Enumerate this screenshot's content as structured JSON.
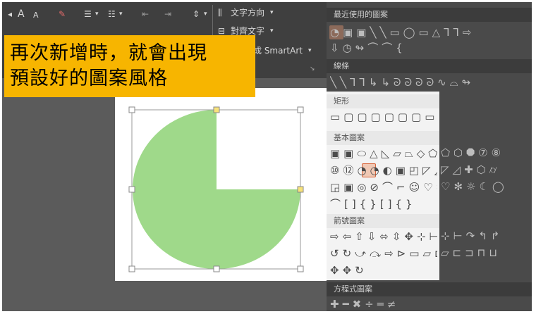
{
  "ribbon": {
    "font_grow": "A",
    "font_shrink": "A",
    "text_direction_label": "文字方向",
    "align_text_label": "對齊文字",
    "smartart_label": "成 SmartArt",
    "dropdown_arrow": "▾",
    "launcher_glyph": "↘"
  },
  "callout": {
    "line1": "再次新增時，就會出現",
    "line2": "預設好的圖案風格",
    "color": "#f7b500"
  },
  "gallery": {
    "sections": {
      "recent": "最近使用的圖案",
      "lines": "線條",
      "rectangles": "矩形",
      "basic": "基本圖案",
      "arrows": "箭號圖案",
      "equation": "方程式圖案"
    },
    "rows": {
      "recent_1": "◔▣▣╲╲▭◯▭△⅂⅂⇨",
      "recent_2": "⇩◷↬⌒⌒{",
      "lines_1": "╲╲⅂⅂↳↳ᘐᘐᘐᘐ∿⌓↬",
      "rect_1": "▭▢▢▢▢▢▢▭▭",
      "basic_1": "▣▣⬭△◺▱⏢◇⬠⬡⯃⑦⑧",
      "basic_2": "⑩⑫◔◔◐▣◰◸◿✚⬡⌭",
      "basic_3": "◲▣◎⊘⌒⌐☺♡✻☼☾◯",
      "basic_4": "⌒[]{}[]{}",
      "arrows_1": "⇨⇦⇧⇩⬄⇳✥⊹⊢↷↰↱",
      "arrows_2": "↺↻⤻⤼⇨⊳▭▱⊏⊐⊓⊔",
      "arrows_3": "✥✥↻",
      "equation_1": "✚━✖÷═≠"
    },
    "colors": {
      "highlight": "#f0c8b4",
      "accent": "#d9643a"
    }
  },
  "slide": {
    "shape_fill": "#9fd98a",
    "handle_adjust": "#f7e27a"
  }
}
